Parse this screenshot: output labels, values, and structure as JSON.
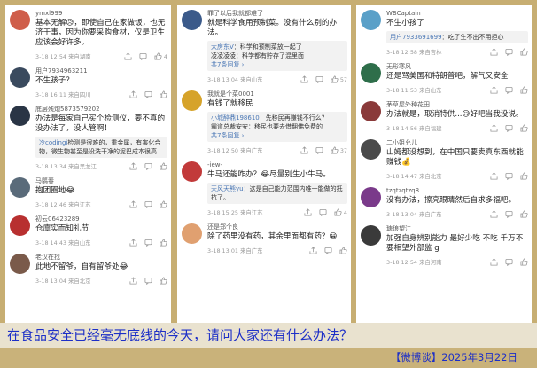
{
  "columns": [
    {
      "comments": [
        {
          "username": "ymxl999",
          "text": "基本无解😥，即使自己在家做饭，也无济于事，因为你要采购食材，仅是卫生应该会好许多。",
          "time": "3-18 12:54 来自湖南",
          "likes": "4",
          "avatar": "#cf5e4a"
        },
        {
          "username": "用户7934963211",
          "text": "不生孩子？",
          "time": "3-18 16:11 来自四川",
          "likes": "",
          "avatar": "#3a4a5e"
        },
        {
          "username": "底层残炮5873579202",
          "text": "办法是每家自己买个检测仪，要不真的没办法了，没人管啊！",
          "reply": {
            "name": "冷codingi",
            "text": "检测是很难的，重金属，有害化合物，微生物甚至是没洗干净的泥巴成本很高...",
            "more": ""
          },
          "time": "3-18 13:34 来自黑龙江",
          "likes": "",
          "avatar": "#2a3545"
        },
        {
          "username": "马騳春",
          "text": "抱团圈地😂",
          "time": "3-18 12:46 来自江苏",
          "likes": "",
          "avatar": "#5a6b7a"
        },
        {
          "username": "初云06423289",
          "text": "仓廪实而知礼节",
          "time": "3-18 14:43 来自山东",
          "likes": "",
          "avatar": "#b83030"
        },
        {
          "username": "老汉在找",
          "text": "此地不留爷，自有留爷处😂",
          "time": "3-18 13:04 来自北京",
          "likes": "",
          "avatar": "#7a5a4a"
        }
      ]
    },
    {
      "comments": [
        {
          "username": "罪了以后我就都难了",
          "text": "就是科学食用预制菜。没有什么别的办法。",
          "reply": {
            "name": "大房东V",
            "text": "：科学和预制菜放一起了\n凌凌凌凌：科学都有貯存了混里面",
            "more": "共7条回复 ›"
          },
          "time": "3-18 13:04 来自山东",
          "likes": "57",
          "avatar": "#3b5a8a"
        },
        {
          "username": "我就是个菜0001",
          "text": "有钱了就移民",
          "reply": {
            "name": "小城醉鼎198610",
            "text": "：先移民再赚钱不行么？\n霸道总裁安安：移民也要去借翻佛免费的",
            "more": "共7条回复 ›"
          },
          "time": "3-18 12:50 来自广东",
          "likes": "37",
          "avatar": "#d6a32a"
        },
        {
          "username": "-iew-",
          "text": "牛马还能咋办？😂尽量别生小牛马。",
          "reply": {
            "name": "天风天熊yu",
            "text": "：这是自己能力范围内唯一能做的抵抗了。",
            "more": ""
          },
          "time": "3-18 15:25 来自江苏",
          "likes": "4",
          "avatar": "#c23a3a"
        },
        {
          "username": "还是郑个良",
          "text": "除了药里没有药，其余里面都有药？😀",
          "time": "3-18 13:01 来自广东",
          "likes": "",
          "avatar": "#e0a070"
        }
      ]
    },
    {
      "comments": [
        {
          "username": "WBCaptain",
          "text": "不生小孩了",
          "reply": {
            "name": "用户7933691699",
            "text": "：吃了生不出不用担心",
            "more": ""
          },
          "time": "3-18 12:58 来自吉林",
          "likes": "",
          "avatar": "#5aa0c8"
        },
        {
          "username": "无形寒风",
          "text": "还是骂美国和特朗普吧，解气又安全",
          "time": "3-18 11:53 来自山东",
          "likes": "",
          "avatar": "#2e6e4a"
        },
        {
          "username": "茅草屋外种花田",
          "text": "办法就是，取消特供...😥好吧当我没说。",
          "time": "3-18 14:56 来自福建",
          "likes": "",
          "avatar": "#8a3a3a"
        },
        {
          "username": "二小姐允儿",
          "text": "山姆都没想到，在中国只要卖真东西就能赚钱💰",
          "time": "3-18 14:47 来自北京",
          "likes": "",
          "avatar": "#4a4a4a"
        },
        {
          "username": "tzqtzqtzq8",
          "text": "没有办法，擦亮眼睛然后自求多福吧。",
          "time": "3-18 13:04 来自广东",
          "likes": "",
          "avatar": "#7a3a8a"
        },
        {
          "username": "瑭琅望江",
          "text": "加强自身辨别能力 最好少吃 不吃 千万不要相望外部监 g",
          "time": "3-18 12:54 来自河南",
          "likes": "",
          "avatar": "#3a3a3a"
        }
      ]
    }
  ],
  "caption": "在食品安全已经毫无底线的今天，请问大家还有什么办法？",
  "credit": "【微博谈】2025年3月22日"
}
